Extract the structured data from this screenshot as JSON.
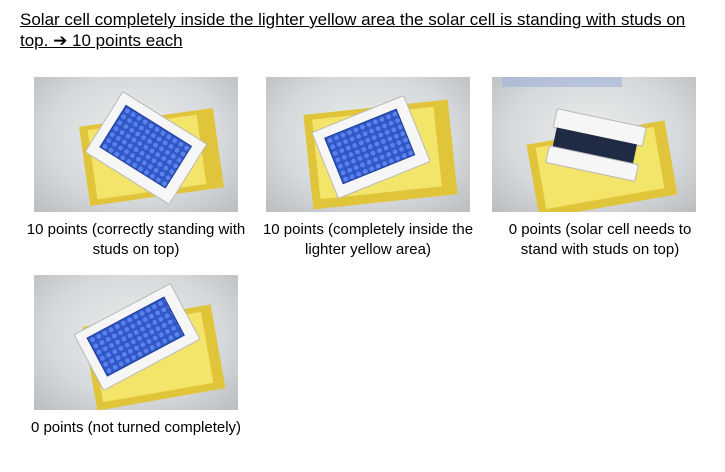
{
  "heading": "Solar cell completely inside the lighter yellow area the solar cell is standing with studs on top. ➔ 10 points each",
  "examples": [
    {
      "caption": "10 points (correctly standing with studs on top)"
    },
    {
      "caption": "10 points (completely inside the lighter yellow area)"
    },
    {
      "caption": "0 points (solar cell needs to stand with studs on top)"
    },
    {
      "caption": "0 points (not turned completely)"
    }
  ]
}
